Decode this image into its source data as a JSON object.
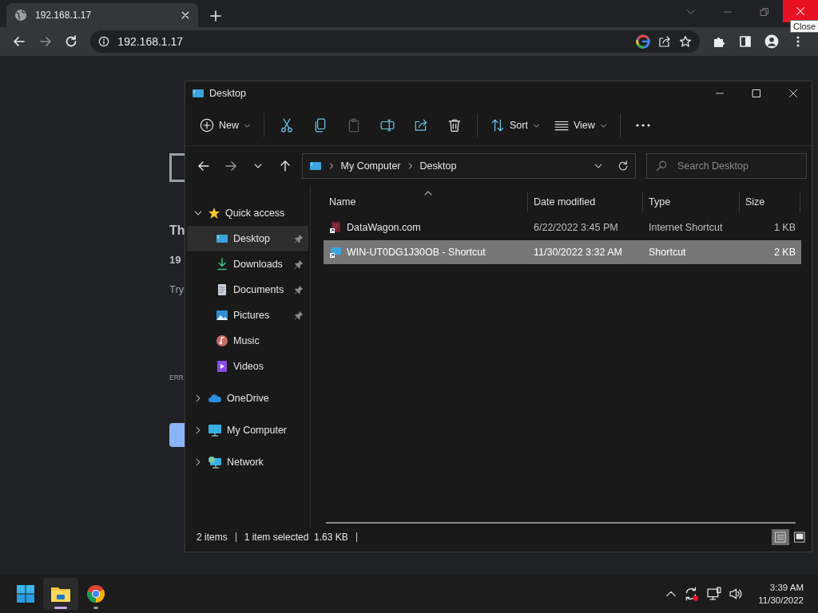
{
  "browser": {
    "tab_title": "192.168.1.17",
    "address": "192.168.1.17",
    "tooltip": "Close"
  },
  "page": {
    "heading": "Th",
    "host": "19",
    "hint": "Try",
    "error_code": "ERR"
  },
  "explorer": {
    "title": "Desktop",
    "command_groups": [
      [
        {
          "kind": "new",
          "label": "New",
          "disabled": false
        }
      ],
      [
        {
          "kind": "cut",
          "disabled": false
        },
        {
          "kind": "copy",
          "disabled": false
        },
        {
          "kind": "paste",
          "disabled": true
        },
        {
          "kind": "rename",
          "disabled": false
        },
        {
          "kind": "share",
          "disabled": false
        },
        {
          "kind": "delete",
          "disabled": false
        }
      ],
      [
        {
          "kind": "sort",
          "label": "Sort",
          "disabled": false
        },
        {
          "kind": "view",
          "label": "View",
          "disabled": false
        }
      ],
      [
        {
          "kind": "more",
          "disabled": false
        }
      ]
    ],
    "breadcrumb": [
      "My Computer",
      "Desktop"
    ],
    "search": {
      "placeholder": "Search Desktop"
    },
    "nav": [
      {
        "kind": "star",
        "label": "Quick access",
        "expanded": true,
        "selected": false,
        "children": [
          {
            "kind": "desktop",
            "label": "Desktop",
            "pinned": true,
            "selected": true
          },
          {
            "kind": "downloads",
            "label": "Downloads",
            "pinned": true,
            "selected": false
          },
          {
            "kind": "documents",
            "label": "Documents",
            "pinned": true,
            "selected": false
          },
          {
            "kind": "pictures",
            "label": "Pictures",
            "pinned": true,
            "selected": false
          },
          {
            "kind": "music",
            "label": "Music",
            "pinned": false,
            "selected": false
          },
          {
            "kind": "videos",
            "label": "Videos",
            "pinned": false,
            "selected": false
          }
        ]
      },
      {
        "kind": "cloud",
        "label": "OneDrive",
        "expanded": false,
        "selected": false
      },
      {
        "kind": "computer",
        "label": "My Computer",
        "expanded": false,
        "selected": false
      },
      {
        "kind": "network",
        "label": "Network",
        "expanded": false,
        "selected": false
      }
    ],
    "columns": [
      "Name",
      "Date modified",
      "Type",
      "Size"
    ],
    "rows": [
      {
        "kind": "internet-shortcut",
        "name": "DataWagon.com",
        "date": "6/22/2022 3:45 PM",
        "type": "Internet Shortcut",
        "size": "1 KB",
        "selected": false
      },
      {
        "kind": "computer-shortcut",
        "name": "WIN-UT0DG1J30OB - Shortcut",
        "date": "11/30/2022 3:32 AM",
        "type": "Shortcut",
        "size": "2 KB",
        "selected": true
      }
    ],
    "status": [
      "2 items",
      "1 item selected  1.63 KB"
    ],
    "view_buttons": [
      {
        "kind": "details",
        "selected": true
      },
      {
        "kind": "tiles",
        "selected": false
      }
    ]
  },
  "taskbar": {
    "apps": [
      {
        "kind": "explorer",
        "active": true
      },
      {
        "kind": "chrome",
        "active": false
      }
    ],
    "time": "3:39 AM",
    "date": "11/30/2022"
  }
}
